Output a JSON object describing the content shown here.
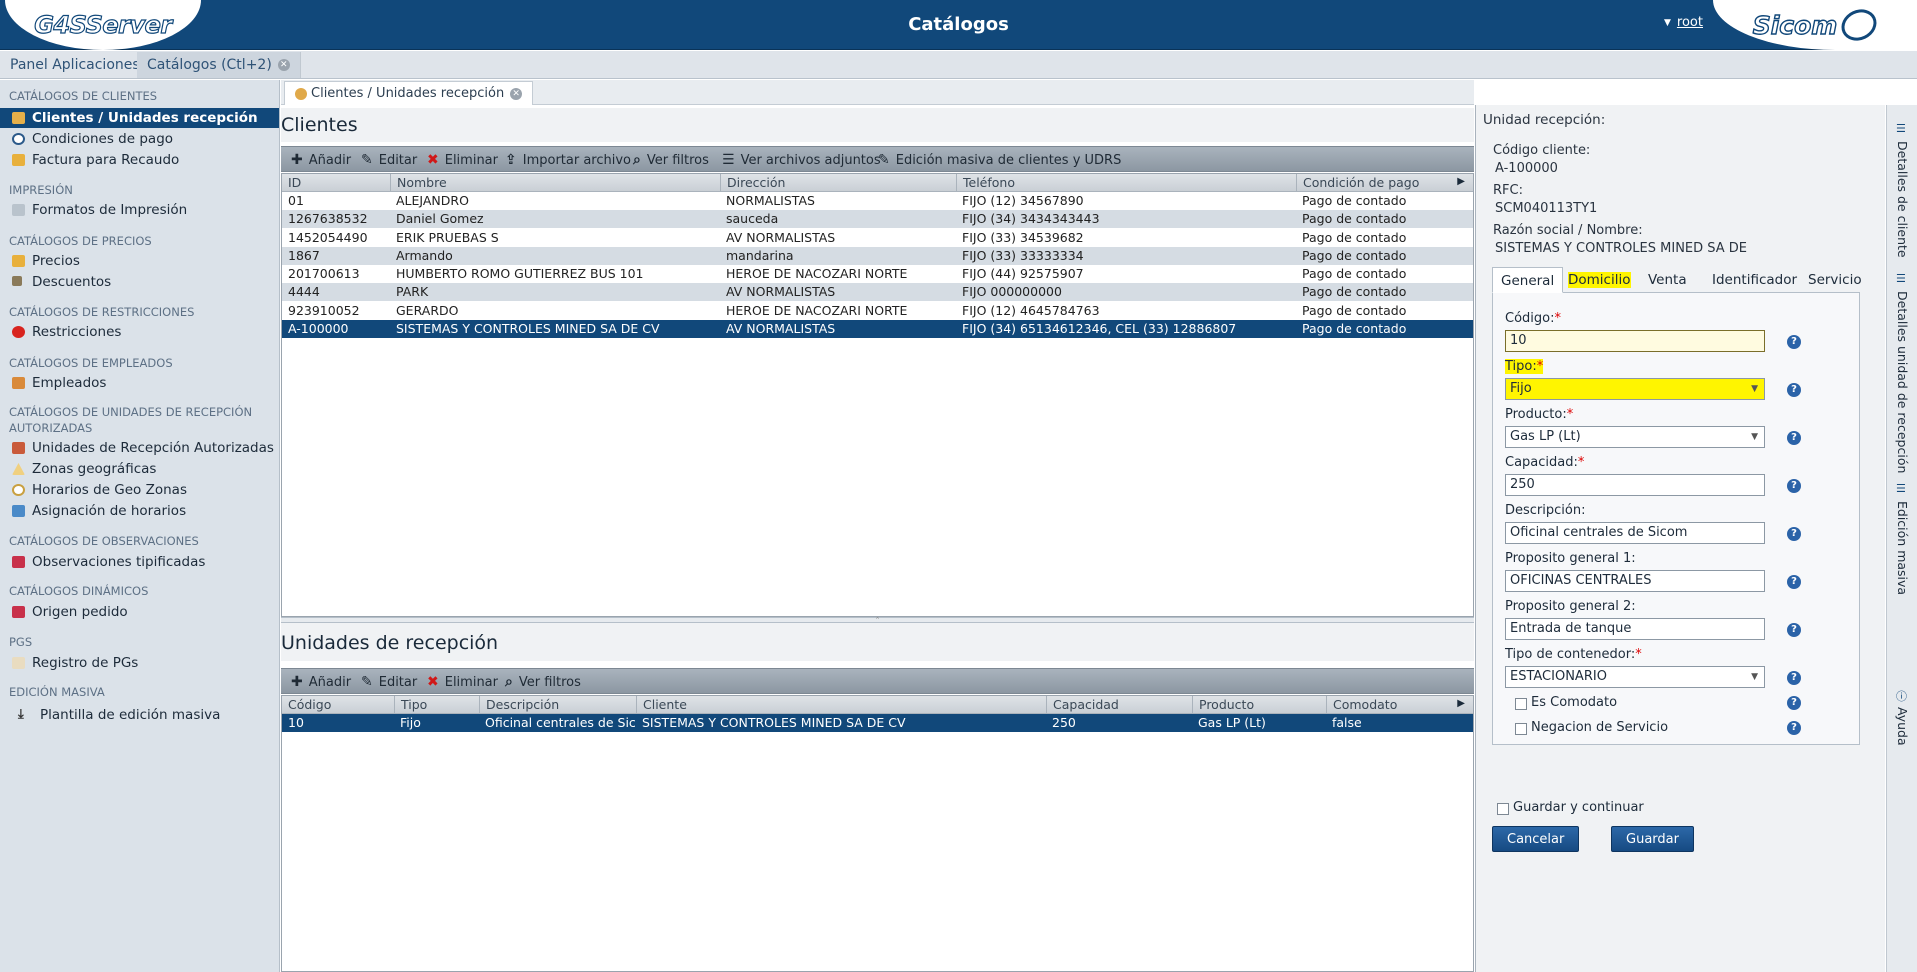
{
  "header": {
    "logo_left": "G4SServer",
    "title": "Catálogos",
    "user": "root",
    "logo_right": "Sicom"
  },
  "top_tabs": [
    {
      "label": "Panel Aplicaciones"
    },
    {
      "label": "Catálogos (Ctl+2)"
    }
  ],
  "sidebar": {
    "sections": [
      {
        "title": "CATÁLOGOS DE CLIENTES",
        "items": [
          "Clientes / Unidades recepción",
          "Condiciones de pago",
          "Factura para Recaudo"
        ]
      },
      {
        "title": "IMPRESIÓN",
        "items": [
          "Formatos de Impresión"
        ]
      },
      {
        "title": "CATÁLOGOS DE PRECIOS",
        "items": [
          "Precios",
          "Descuentos"
        ]
      },
      {
        "title": "CATÁLOGOS DE RESTRICCIONES",
        "items": [
          "Restricciones"
        ]
      },
      {
        "title": "CATÁLOGOS DE EMPLEADOS",
        "items": [
          "Empleados"
        ]
      },
      {
        "title": "CATÁLOGOS DE UNIDADES DE RECEPCIÓN AUTORIZADAS",
        "items": [
          "Unidades de Recepción Autorizadas",
          "Zonas geográficas",
          "Horarios de Geo Zonas",
          "Asignación de horarios"
        ]
      },
      {
        "title": "CATÁLOGOS DE OBSERVACIONES",
        "items": [
          "Observaciones tipificadas"
        ]
      },
      {
        "title": "CATÁLOGOS DINÁMICOS",
        "items": [
          "Origen pedido"
        ]
      },
      {
        "title": "PGS",
        "items": [
          "Registro de PGs"
        ]
      },
      {
        "title": "EDICIÓN MASIVA",
        "items": [
          "Plantilla de edición masiva"
        ]
      }
    ],
    "selected": "Clientes / Unidades recepción"
  },
  "inner_tab": {
    "label": "Clientes / Unidades recepción"
  },
  "clientes": {
    "title": "Clientes",
    "toolbar": [
      "Añadir",
      "Editar",
      "Eliminar",
      "Importar archivo",
      "Ver filtros",
      "Ver archivos adjuntos",
      "Edición masiva de clientes y UDRS"
    ],
    "columns": [
      "ID",
      "Nombre",
      "Dirección",
      "Teléfono",
      "Condición de pago"
    ],
    "rows": [
      [
        "01",
        "ALEJANDRO",
        "NORMALISTAS",
        "FIJO (12) 34567890",
        "Pago de contado"
      ],
      [
        "1267638532",
        "Daniel Gomez",
        "sauceda",
        "FIJO (34) 3434343443",
        "Pago de contado"
      ],
      [
        "1452054490",
        "ERIK PRUEBAS S",
        "AV NORMALISTAS",
        "FIJO (33) 34539682",
        "Pago de contado"
      ],
      [
        "1867",
        "Armando",
        "mandarina",
        "FIJO (33) 33333334",
        "Pago de contado"
      ],
      [
        "201700613",
        "HUMBERTO ROMO GUTIERREZ BUS 101",
        "HEROE DE NACOZARI NORTE",
        "FIJO (44) 92575907",
        "Pago de contado"
      ],
      [
        "4444",
        "PARK",
        "AV NORMALISTAS",
        "FIJO 000000000",
        "Pago de contado"
      ],
      [
        "923910052",
        "GERARDO",
        "HEROE DE NACOZARI NORTE",
        "FIJO (12) 4645784763",
        "Pago de contado"
      ],
      [
        "A-100000",
        "SISTEMAS Y CONTROLES MINED SA DE CV",
        "AV NORMALISTAS",
        "FIJO (34) 65134612346, CEL (33) 12886807",
        "Pago de contado"
      ]
    ]
  },
  "unidades": {
    "title": "Unidades de recepción",
    "toolbar": [
      "Añadir",
      "Editar",
      "Eliminar",
      "Ver filtros"
    ],
    "columns": [
      "Código",
      "Tipo",
      "Descripción",
      "Cliente",
      "Capacidad",
      "Producto",
      "Comodato"
    ],
    "rows": [
      [
        "10",
        "Fijo",
        "Oficinal centrales de Sico",
        "SISTEMAS Y CONTROLES MINED SA DE CV",
        "250",
        "Gas LP (Lt)",
        "false"
      ]
    ]
  },
  "form": {
    "heading": "Unidad recepción:",
    "codigo_cliente_label": "Código cliente:",
    "codigo_cliente": "A-100000",
    "rfc_label": "RFC:",
    "rfc": "SCM040113TY1",
    "razon_label": "Razón social / Nombre:",
    "razon": "SISTEMAS Y CONTROLES MINED SA DE",
    "tabs": [
      "General",
      "Domicilio",
      "Venta",
      "Identificador",
      "Servicio"
    ],
    "fields": {
      "codigo": {
        "label": "Código:",
        "value": "10"
      },
      "tipo": {
        "label": "Tipo:",
        "value": "Fijo"
      },
      "producto": {
        "label": "Producto:",
        "value": "Gas LP (Lt)"
      },
      "capacidad": {
        "label": "Capacidad:",
        "value": "250"
      },
      "descripcion": {
        "label": "Descripción:",
        "value": "Oficinal centrales de Sicom"
      },
      "proposito1": {
        "label": "Proposito general 1:",
        "value": "OFICINAS CENTRALES"
      },
      "proposito2": {
        "label": "Proposito general 2:",
        "value": "Entrada de tanque"
      },
      "contenedor": {
        "label": "Tipo de contenedor:",
        "value": "ESTACIONARIO"
      }
    },
    "es_comodato": "Es Comodato",
    "negacion": "Negacion de Servicio",
    "guardar_continuar": "Guardar y continuar",
    "cancelar": "Cancelar",
    "guardar": "Guardar"
  },
  "vstrip": [
    "Detalles de cliente",
    "Detalles unidad de recepción",
    "Edición masiva",
    "Ayuda"
  ],
  "colors": {
    "header": "#11487a",
    "selected": "#11487a",
    "highlight": "#fff500"
  }
}
